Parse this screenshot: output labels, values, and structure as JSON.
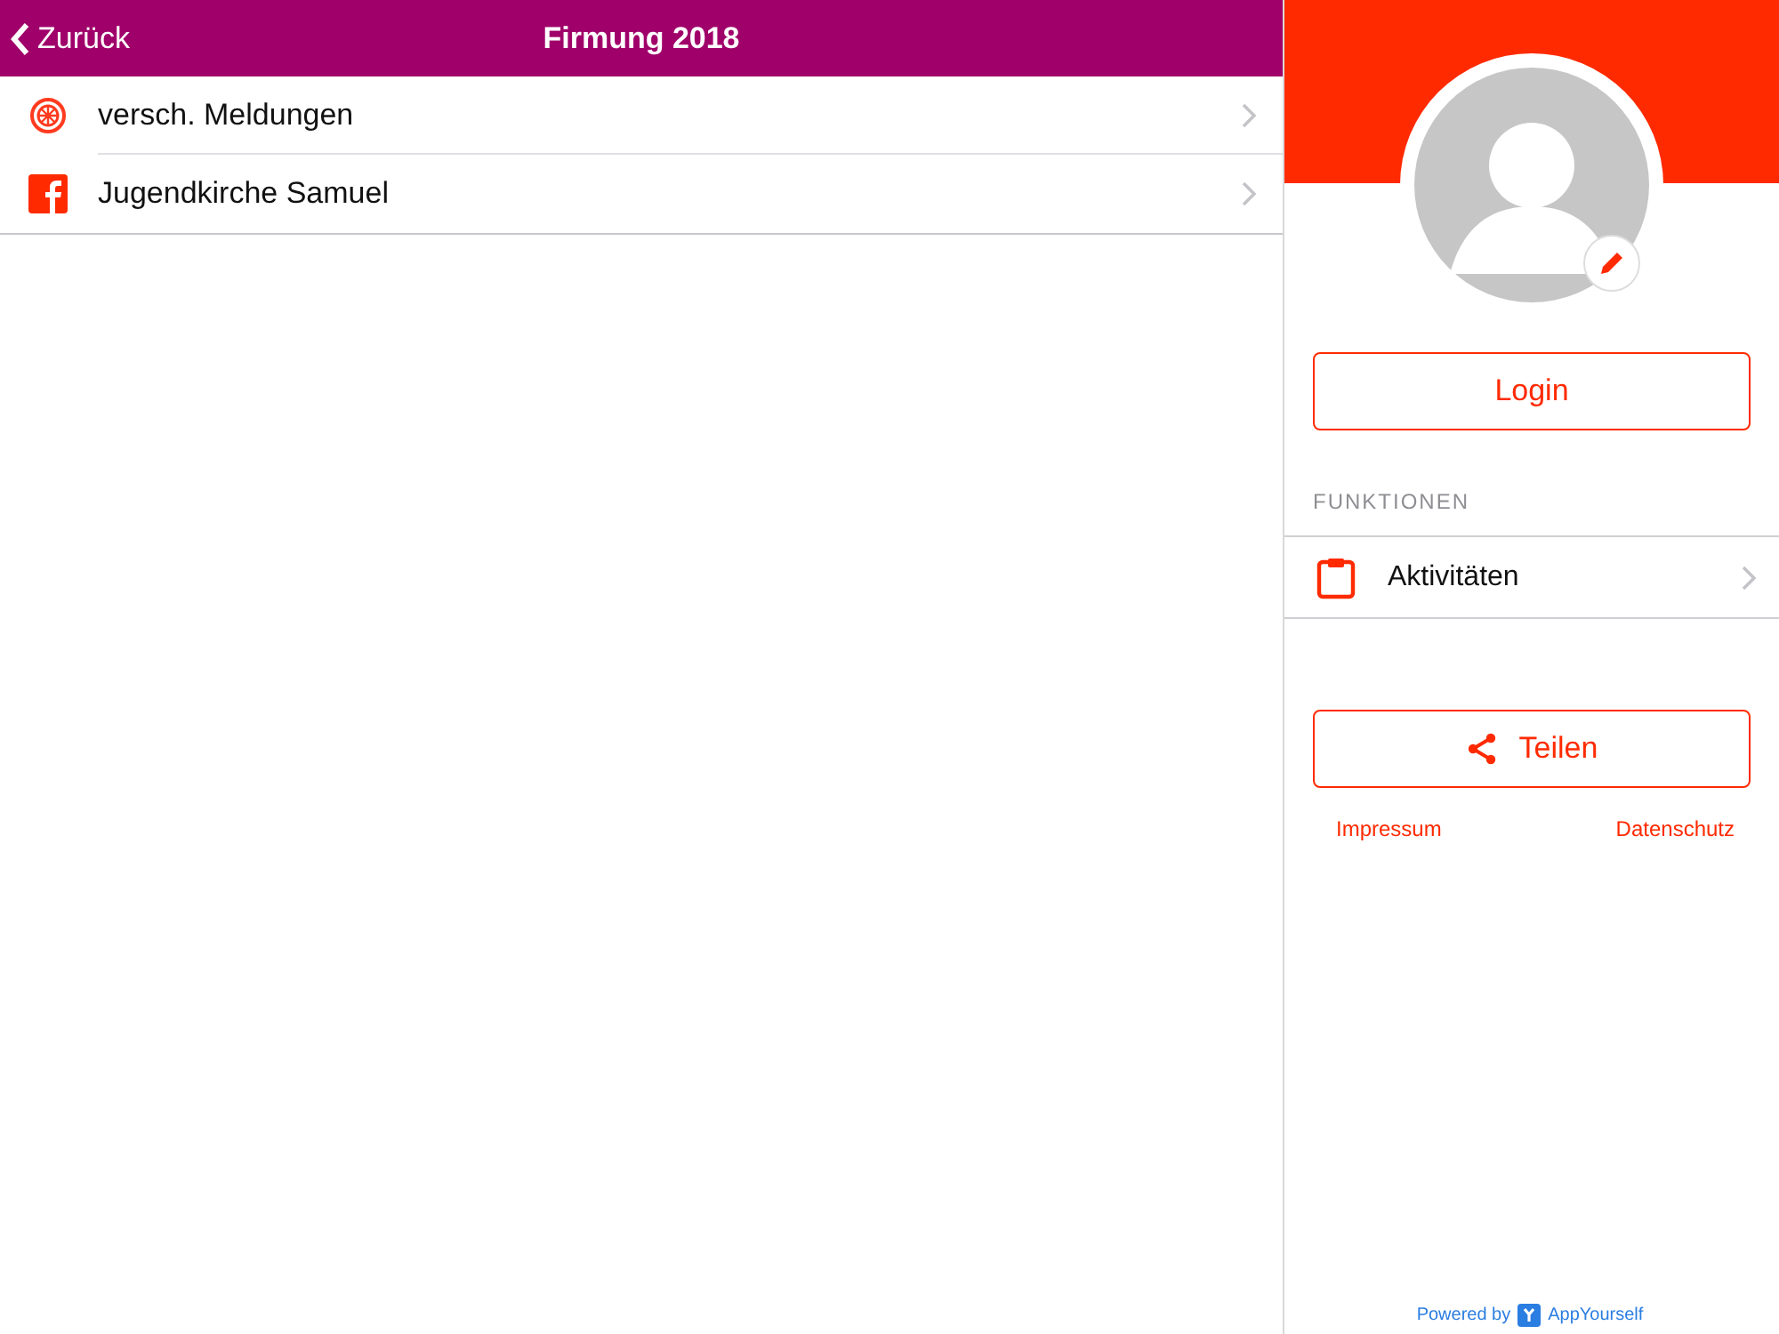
{
  "nav": {
    "back": "Zurück",
    "title": "Firmung 2018"
  },
  "items": [
    {
      "kind": "wheel",
      "label": "versch. Meldungen"
    },
    {
      "kind": "facebook",
      "label": "Jugendkirche Samuel"
    }
  ],
  "profile": {
    "login": "Login",
    "section": "FUNKTIONEN",
    "functions": [
      {
        "label": "Aktivitäten"
      }
    ],
    "share": "Teilen",
    "links": [
      "Impressum",
      "Datenschutz"
    ],
    "powered_by": "Powered by",
    "brand": "AppYourself"
  }
}
